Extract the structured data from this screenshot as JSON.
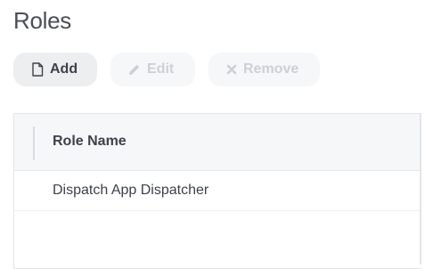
{
  "page": {
    "title": "Roles"
  },
  "toolbar": {
    "add_label": "Add",
    "edit_label": "Edit",
    "remove_label": "Remove",
    "icons": {
      "add": "file-icon",
      "edit": "pencil-icon",
      "remove": "x-icon"
    }
  },
  "grid": {
    "columns": [
      "Role Name"
    ],
    "rows": [
      {
        "role_name": "Dispatch App Dispatcher"
      }
    ]
  }
}
